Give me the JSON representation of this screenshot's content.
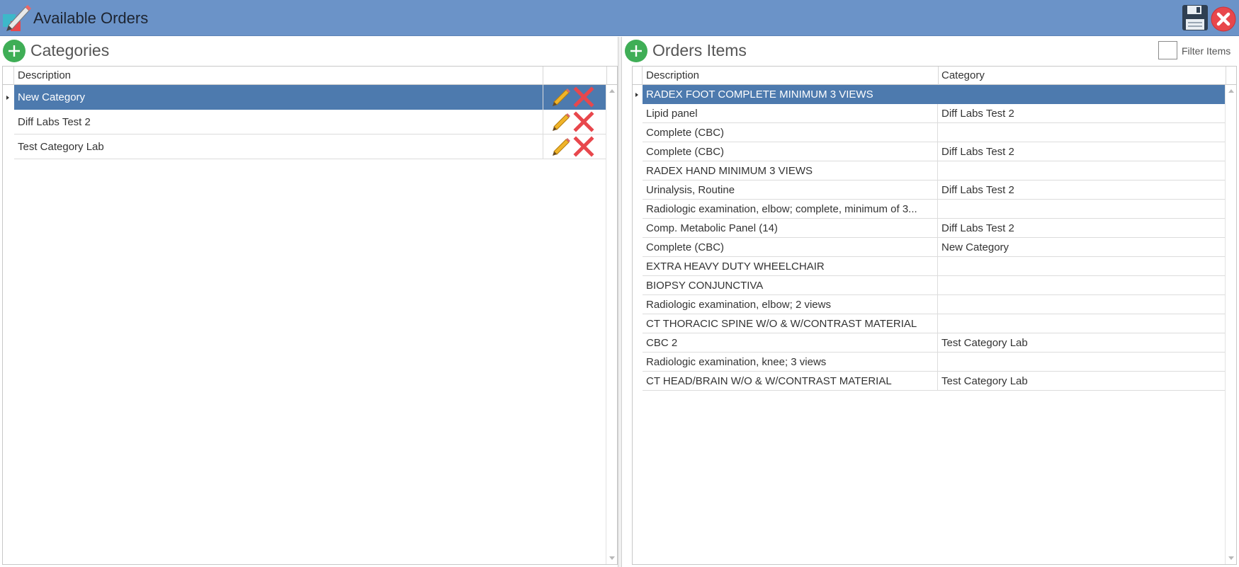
{
  "window": {
    "title": "Available Orders"
  },
  "categories": {
    "title": "Categories",
    "columns": [
      "Description"
    ],
    "rows": [
      {
        "description": "New Category",
        "selected": true
      },
      {
        "description": "Diff Labs Test 2",
        "selected": false
      },
      {
        "description": "Test Category Lab",
        "selected": false
      }
    ]
  },
  "orders": {
    "title": "Orders Items",
    "filter_label": "Filter Items",
    "columns": [
      "Description",
      "Category"
    ],
    "rows": [
      {
        "description": "RADEX FOOT COMPLETE MINIMUM 3 VIEWS",
        "category": "",
        "selected": true
      },
      {
        "description": "Lipid panel",
        "category": "Diff Labs Test 2"
      },
      {
        "description": "Complete (CBC)",
        "category": ""
      },
      {
        "description": "Complete (CBC)",
        "category": "Diff Labs Test 2"
      },
      {
        "description": "RADEX HAND MINIMUM 3 VIEWS",
        "category": ""
      },
      {
        "description": "Urinalysis, Routine",
        "category": "Diff Labs Test 2"
      },
      {
        "description": "Radiologic examination, elbow; complete, minimum of 3...",
        "category": ""
      },
      {
        "description": "Comp. Metabolic Panel (14)",
        "category": "Diff Labs Test 2"
      },
      {
        "description": "Complete (CBC)",
        "category": "New Category"
      },
      {
        "description": "EXTRA HEAVY DUTY WHEELCHAIR",
        "category": ""
      },
      {
        "description": "BIOPSY CONJUNCTIVA",
        "category": ""
      },
      {
        "description": "Radiologic examination, elbow; 2 views",
        "category": ""
      },
      {
        "description": "CT THORACIC SPINE W/O & W/CONTRAST MATERIAL",
        "category": ""
      },
      {
        "description": "CBC 2",
        "category": "Test Category Lab"
      },
      {
        "description": "Radiologic examination, knee; 3 views",
        "category": ""
      },
      {
        "description": "CT HEAD/BRAIN W/O & W/CONTRAST MATERIAL",
        "category": "Test Category Lab"
      }
    ]
  },
  "colors": {
    "titlebar": "#6b93c8",
    "selection": "#4d7aae",
    "add": "#3fae56",
    "delete": "#e8474c",
    "edit": "#f0b429"
  }
}
